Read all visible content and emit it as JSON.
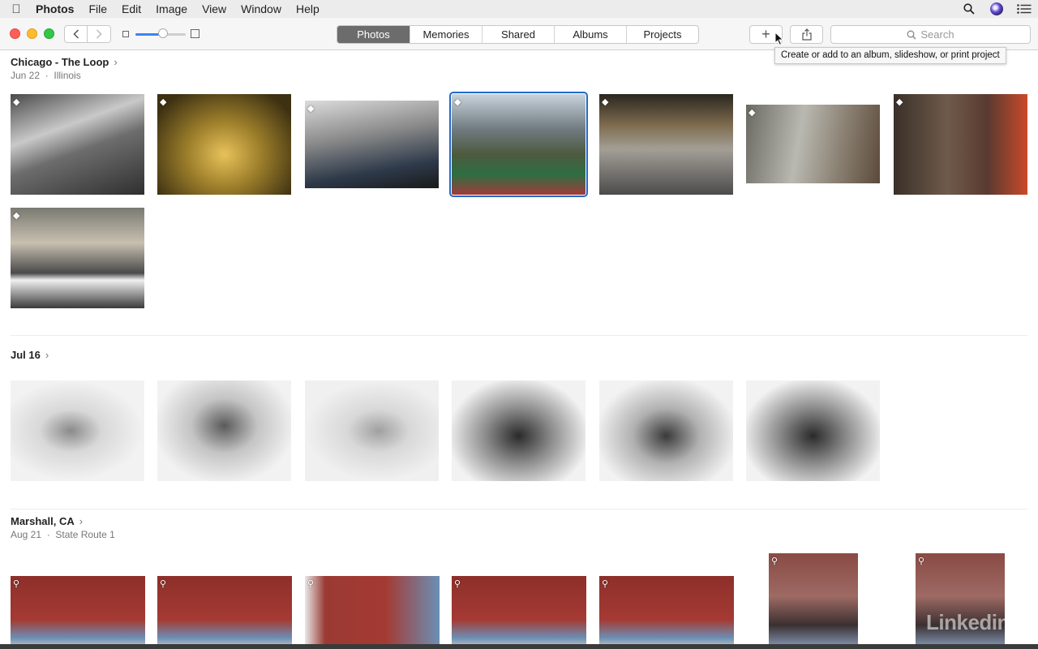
{
  "menubar": {
    "app_name": "Photos",
    "items": [
      "File",
      "Edit",
      "Image",
      "View",
      "Window",
      "Help"
    ]
  },
  "toolbar": {
    "tabs": [
      {
        "label": "Photos",
        "active": true
      },
      {
        "label": "Memories",
        "active": false
      },
      {
        "label": "Shared",
        "active": false
      },
      {
        "label": "Albums",
        "active": false
      },
      {
        "label": "Projects",
        "active": false
      }
    ],
    "search_placeholder": "Search",
    "add_tooltip": "Create or add to an album, slideshow, or print project",
    "zoom_level": 0.55
  },
  "sections": [
    {
      "title": "Chicago - The Loop",
      "date": "Jun 22",
      "place": "Illinois"
    },
    {
      "title": "Jul 16",
      "date": "",
      "place": ""
    },
    {
      "title": "Marshall, CA",
      "date": "Aug 21",
      "place": "State Route 1"
    }
  ],
  "colors": {
    "accent": "#3b82f6",
    "selection": "#2169c9",
    "active_tab": "#6c6c6c",
    "close": "#fc5f57",
    "minimize": "#fdbc2e",
    "zoom": "#33c748"
  },
  "watermark": "Linkedin"
}
